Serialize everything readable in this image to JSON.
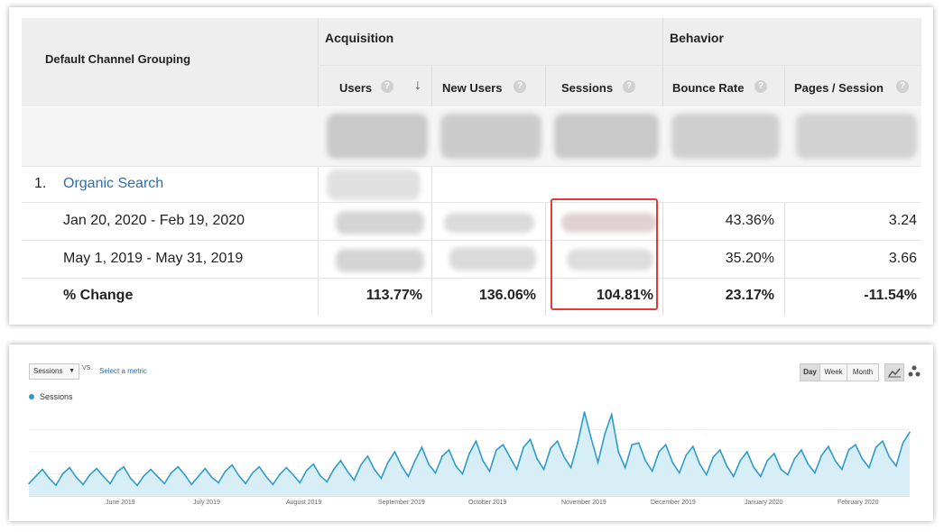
{
  "table": {
    "channel_header": "Default Channel Grouping",
    "group_acquisition": "Acquisition",
    "group_behavior": "Behavior",
    "columns": [
      "Users",
      "New Users",
      "Sessions",
      "Bounce Rate",
      "Pages / Session"
    ],
    "help_glyph": "?",
    "sort_glyph": "↓",
    "row_group": {
      "index": "1.",
      "label": "Organic Search"
    },
    "rows": [
      {
        "label": "Jan 20, 2020 - Feb 19, 2020",
        "bounce_rate": "43.36%",
        "pages_session": "3.24"
      },
      {
        "label": "May 1, 2019 - May 31, 2019",
        "bounce_rate": "35.20%",
        "pages_session": "3.66"
      }
    ],
    "change": {
      "label": "% Change",
      "users": "113.77%",
      "new_users": "136.06%",
      "sessions": "104.81%",
      "bounce_rate": "23.17%",
      "pages_session": "-11.54%"
    },
    "link_color": "#2b6cb0",
    "highlight_color": "#e53935"
  },
  "chart": {
    "metric_select": "Sessions",
    "vs_label": "VS.",
    "select_metric_link": "Select a metric",
    "legend_label": "Sessions",
    "granularity": [
      "Day",
      "Week",
      "Month"
    ],
    "granularity_selected": "Day",
    "icons": [
      "line-chart-icon",
      "motion-chart-icon"
    ],
    "series_color": "#2e9bc9"
  },
  "chart_data": {
    "type": "area",
    "series": [
      {
        "name": "Sessions",
        "values": [
          14,
          22,
          30,
          20,
          12,
          25,
          32,
          21,
          13,
          24,
          31,
          22,
          14,
          27,
          33,
          20,
          12,
          23,
          30,
          22,
          14,
          26,
          33,
          24,
          13,
          22,
          31,
          21,
          15,
          28,
          35,
          23,
          14,
          26,
          33,
          22,
          13,
          24,
          32,
          24,
          15,
          29,
          36,
          23,
          16,
          30,
          40,
          28,
          18,
          35,
          45,
          30,
          20,
          38,
          50,
          34,
          22,
          40,
          55,
          36,
          26,
          45,
          52,
          34,
          25,
          48,
          62,
          40,
          28,
          52,
          58,
          44,
          30,
          55,
          64,
          42,
          30,
          54,
          62,
          44,
          32,
          60,
          95,
          65,
          38,
          70,
          92,
          50,
          32,
          58,
          60,
          40,
          28,
          50,
          58,
          38,
          26,
          46,
          56,
          36,
          24,
          44,
          52,
          34,
          22,
          40,
          50,
          32,
          22,
          40,
          48,
          30,
          24,
          42,
          52,
          36,
          26,
          46,
          56,
          40,
          30,
          52,
          58,
          42,
          32,
          55,
          62,
          44,
          34,
          60,
          72
        ]
      }
    ],
    "x_ticks": [
      "June 2019",
      "July 2019",
      "August 2019",
      "September 2019",
      "October 2019",
      "November 2019",
      "December 2019",
      "January 2020",
      "February 2020"
    ],
    "ylim": [
      0,
      100
    ],
    "grid": true,
    "legend": "top-left"
  }
}
